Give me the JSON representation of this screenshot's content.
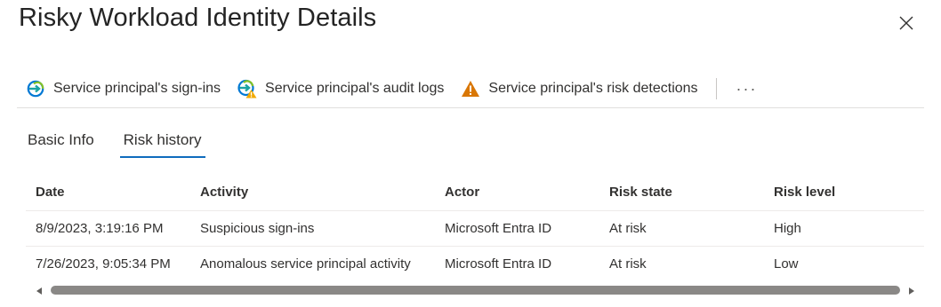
{
  "panel": {
    "title": "Risky Workload Identity Details"
  },
  "toolbar": {
    "items": [
      {
        "label": "Service principal's sign-ins",
        "icon": "sign-in-arrow-icon"
      },
      {
        "label": "Service principal's audit logs",
        "icon": "audit-log-warning-icon"
      },
      {
        "label": "Service principal's risk detections",
        "icon": "warning-triangle-icon"
      }
    ],
    "more_label": "···"
  },
  "tabs": [
    {
      "label": "Basic Info",
      "active": false
    },
    {
      "label": "Risk history",
      "active": true
    }
  ],
  "table": {
    "headers": [
      "Date",
      "Activity",
      "Actor",
      "Risk state",
      "Risk level"
    ],
    "rows": [
      [
        "8/9/2023, 3:19:16 PM",
        "Suspicious sign-ins",
        "Microsoft Entra ID",
        "At risk",
        "High"
      ],
      [
        "7/26/2023, 9:05:34 PM",
        "Anomalous service principal activity",
        "Microsoft Entra ID",
        "At risk",
        "Low"
      ]
    ]
  },
  "colors": {
    "accent": "#0f6cbd",
    "warning": "#d97706",
    "signin_teal": "#2aa0a4",
    "signin_blue": "#0078d4"
  }
}
